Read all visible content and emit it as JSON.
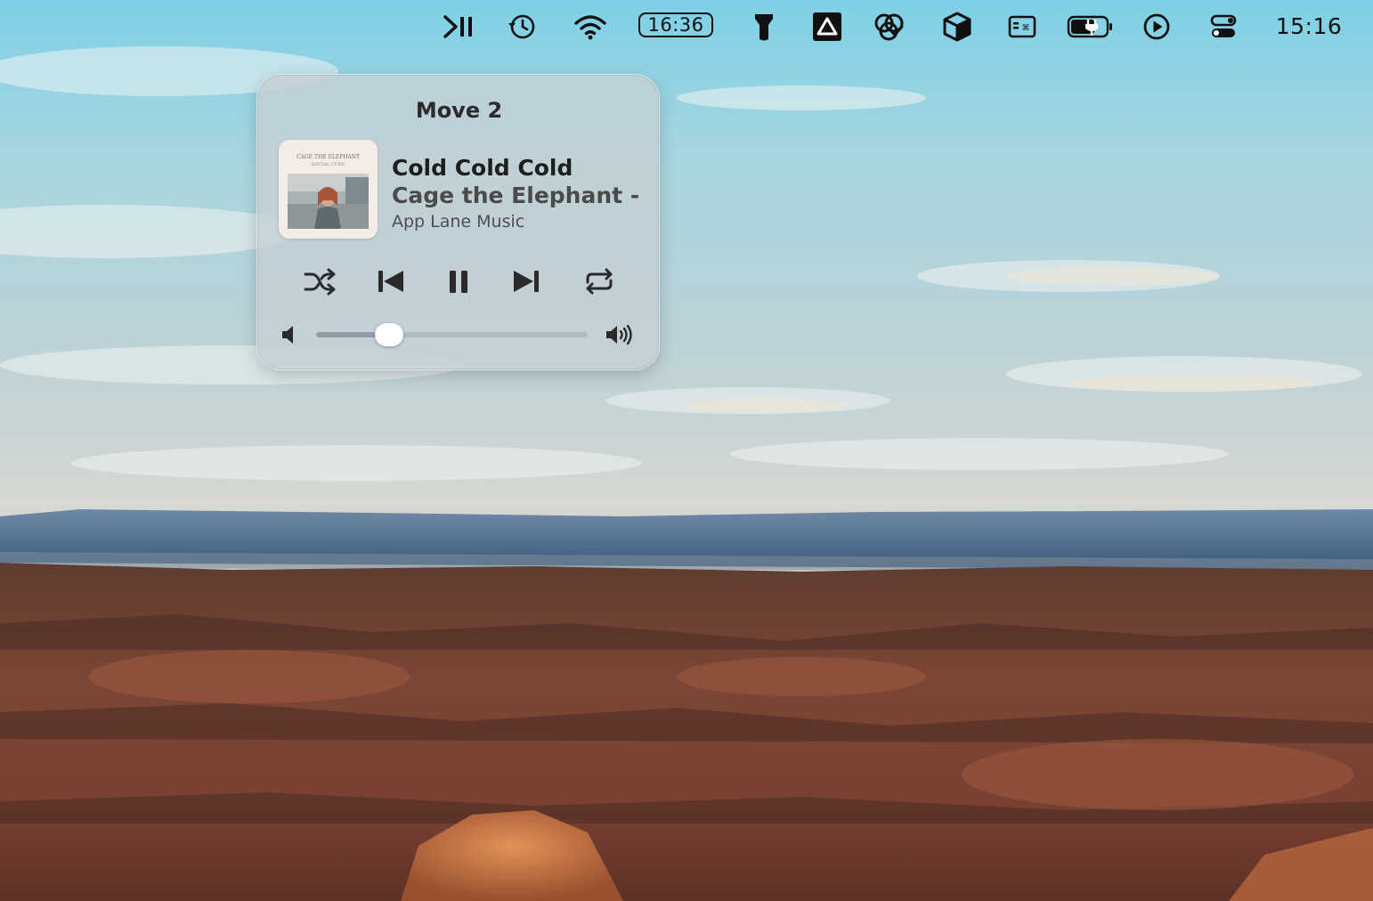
{
  "menubar": {
    "items": [
      {
        "icon": "skip-pause-icon"
      },
      {
        "icon": "time-machine-icon"
      },
      {
        "icon": "wifi-icon"
      },
      {
        "icon": "flashlight-icon"
      },
      {
        "icon": "google-drive-icon"
      },
      {
        "icon": "creative-cloud-icon"
      },
      {
        "icon": "box-icon"
      },
      {
        "icon": "keyboard-icon"
      },
      {
        "icon": "battery-charging-icon"
      },
      {
        "icon": "play-circle-icon"
      },
      {
        "icon": "control-center-icon"
      }
    ],
    "badge_time": "16:36",
    "time": "15:16"
  },
  "player": {
    "title": "Move 2",
    "track": "Cold Cold Cold",
    "artist": "Cage the Elephant - T",
    "source": "App Lane Music",
    "album_art_caption_top": "CAGE THE ELEPHANT",
    "album_art_caption_bottom": "SOCIAL CUES",
    "volume_level": 0.27,
    "controls": {
      "shuffle": "shuffle-icon",
      "previous": "previous-icon",
      "play_pause": "pause-icon",
      "next": "next-icon",
      "repeat": "repeat-icon"
    }
  },
  "colors": {
    "popover_bg": "#c4cfd4",
    "text_primary": "#1e1e1e",
    "text_secondary": "#4a4a4a"
  }
}
